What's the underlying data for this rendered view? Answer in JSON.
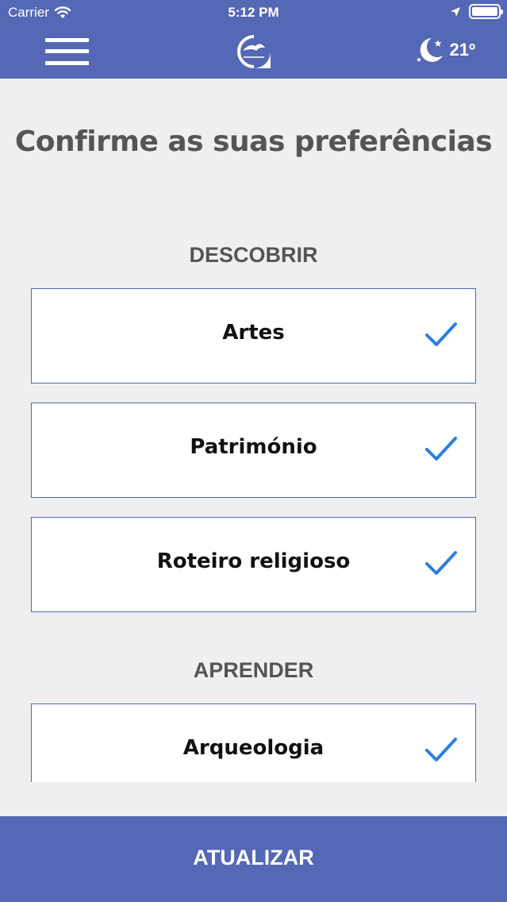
{
  "status_bar": {
    "carrier": "Carrier",
    "time": "5:12 PM",
    "icons": [
      "wifi-icon",
      "location-arrow-icon",
      "battery-icon"
    ]
  },
  "header": {
    "menu_icon": "hamburger-menu-icon",
    "logo_icon": "app-logo-icon",
    "weather_icon": "moon-night-icon",
    "temperature": "21º",
    "background_color": "#5468b6"
  },
  "main": {
    "title": "Confirme as suas preferências",
    "sections": [
      {
        "label": "DESCOBRIR",
        "items": [
          {
            "label": "Artes",
            "checked": true
          },
          {
            "label": "Património",
            "checked": true
          },
          {
            "label": "Roteiro religioso",
            "checked": true
          }
        ]
      },
      {
        "label": "APRENDER",
        "items": [
          {
            "label": "Arqueologia",
            "checked": true
          }
        ]
      }
    ],
    "check_color": "#2a7fe0"
  },
  "footer": {
    "button_label": "ATUALIZAR"
  }
}
